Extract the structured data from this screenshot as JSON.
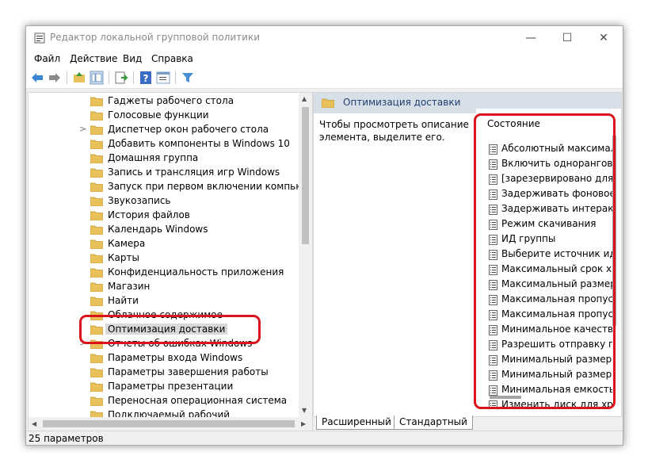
{
  "window": {
    "title": "Редактор локальной групповой политики",
    "controls": {
      "minimize": "—",
      "maximize": "☐",
      "close": "✕"
    }
  },
  "menu": [
    "Файл",
    "Действие",
    "Вид",
    "Справка"
  ],
  "toolbar": [
    "back-arrow-icon",
    "forward-arrow-icon",
    "up-folder-icon",
    "show-tree-icon",
    "export-icon",
    "help-icon",
    "properties-icon",
    "filter-icon"
  ],
  "tree": {
    "items": [
      {
        "label": "Гаджеты рабочего стола",
        "expandable": false
      },
      {
        "label": "Голосовые функции",
        "expandable": false
      },
      {
        "label": "Диспетчер окон рабочего стола",
        "expandable": true
      },
      {
        "label": "Добавить компоненты в Windows 10",
        "expandable": false
      },
      {
        "label": "Домашняя группа",
        "expandable": false
      },
      {
        "label": "Запись и трансляция игр Windows",
        "expandable": false
      },
      {
        "label": "Запуск при первом включении компьютер",
        "expandable": false
      },
      {
        "label": "Звукозапись",
        "expandable": false
      },
      {
        "label": "История файлов",
        "expandable": false
      },
      {
        "label": "Календарь Windows",
        "expandable": false
      },
      {
        "label": "Камера",
        "expandable": false
      },
      {
        "label": "Карты",
        "expandable": false
      },
      {
        "label": "Конфиденциальность приложения",
        "expandable": false
      },
      {
        "label": "Магазин",
        "expandable": false
      },
      {
        "label": "Найти",
        "expandable": false
      },
      {
        "label": "Облачное содержимое",
        "expandable": false
      },
      {
        "label": "Оптимизация доставки",
        "expandable": false,
        "selected": true
      },
      {
        "label": "Отчеты об ошибках Windows",
        "expandable": true
      },
      {
        "label": "Параметры входа Windows",
        "expandable": false
      },
      {
        "label": "Параметры завершения работы",
        "expandable": false
      },
      {
        "label": "Параметры презентации",
        "expandable": false
      },
      {
        "label": "Переносная операционная система",
        "expandable": false
      },
      {
        "label": "Подключаемый рабочий",
        "expandable": false
      }
    ]
  },
  "right": {
    "header": "Оптимизация доставки",
    "description": "Чтобы просмотреть описание элемента, выделите его.",
    "column": "Состояние",
    "settings": [
      "Абсолютный максимальный",
      "Включить одноранговое",
      "[зарезервировано для ис",
      "Задерживать фоновое с",
      "Задерживать интерактив",
      "Режим скачивания",
      "ИД группы",
      "Выберите источник иден",
      "Максимальный срок хра",
      "Максимальный размер к",
      "Максимальная пропускн",
      "Максимальная пропускн",
      "Минимальное качество",
      "Разрешить отправку при",
      "Минимальный размер д",
      "Минимальный размер ф",
      "Минимальная емкость С",
      "Изменить диск для хранен"
    ]
  },
  "tabs": [
    "Расширенный",
    "Стандартный"
  ],
  "status": "25 параметров",
  "colors": {
    "highlight": "#d9141c",
    "folder": "#e8c15a",
    "header_bg": "#d7dfe9"
  }
}
